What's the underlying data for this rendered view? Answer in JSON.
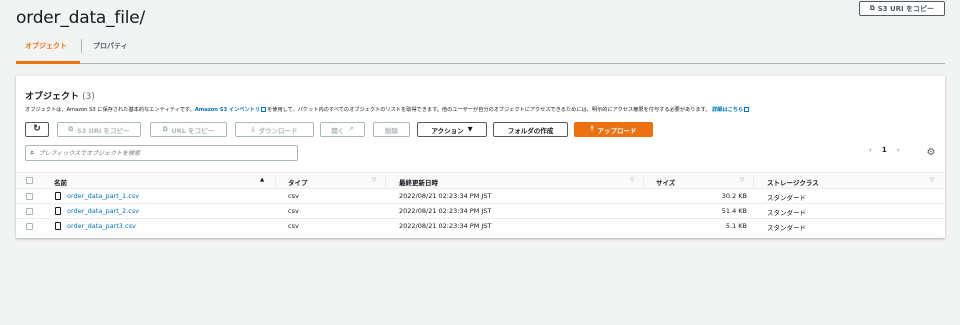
{
  "page": {
    "title": "order_data_file/",
    "copy_s3_uri": "S3 URI をコピー"
  },
  "tabs": {
    "objects": "オブジェクト",
    "properties": "プロパティ"
  },
  "panel": {
    "title": "オブジェクト",
    "count": "(3)",
    "desc_prefix": "オブジェクトは、Amazon S3 に保存された基本的なエンティティです。",
    "desc_link1": "Amazon S3 インベントリ",
    "desc_middle": "を使用して、バケット内のすべてのオブジェクトのリストを取得できます。他のユーザーが自分のオブジェクトにアクセスできるためには、明示的にアクセス権限を付与する必要があります。",
    "desc_link2": "詳細はこちら"
  },
  "toolbar": {
    "copy_s3_uri": "S3 URI をコピー",
    "copy_url": "URL をコピー",
    "download": "ダウンロード",
    "open": "開く",
    "delete": "削除",
    "actions": "アクション",
    "create_folder": "フォルダの作成",
    "upload": "アップロード"
  },
  "search": {
    "placeholder": "プレフィックスでオブジェクトを検索"
  },
  "pager": {
    "current": "1"
  },
  "table": {
    "headers": {
      "name": "名前",
      "type": "タイプ",
      "modified": "最終更新日時",
      "size": "サイズ",
      "storage": "ストレージクラス"
    },
    "rows": [
      {
        "name": "order_data_part_1.csv",
        "type": "csv",
        "modified": "2022/08/21 02:23:34 PM JST",
        "size": "30.2 KB",
        "storage": "スタンダード"
      },
      {
        "name": "order_data_part_2.csv",
        "type": "csv",
        "modified": "2022/08/21 02:23:34 PM JST",
        "size": "51.4 KB",
        "storage": "スタンダード"
      },
      {
        "name": "order_data_part3.csv",
        "type": "csv",
        "modified": "2022/08/21 02:23:34 PM JST",
        "size": "5.1 KB",
        "storage": "スタンダード"
      }
    ]
  },
  "colors": {
    "accent": "#ec7211",
    "link": "#0073bb",
    "background": "#f2f3f3"
  }
}
